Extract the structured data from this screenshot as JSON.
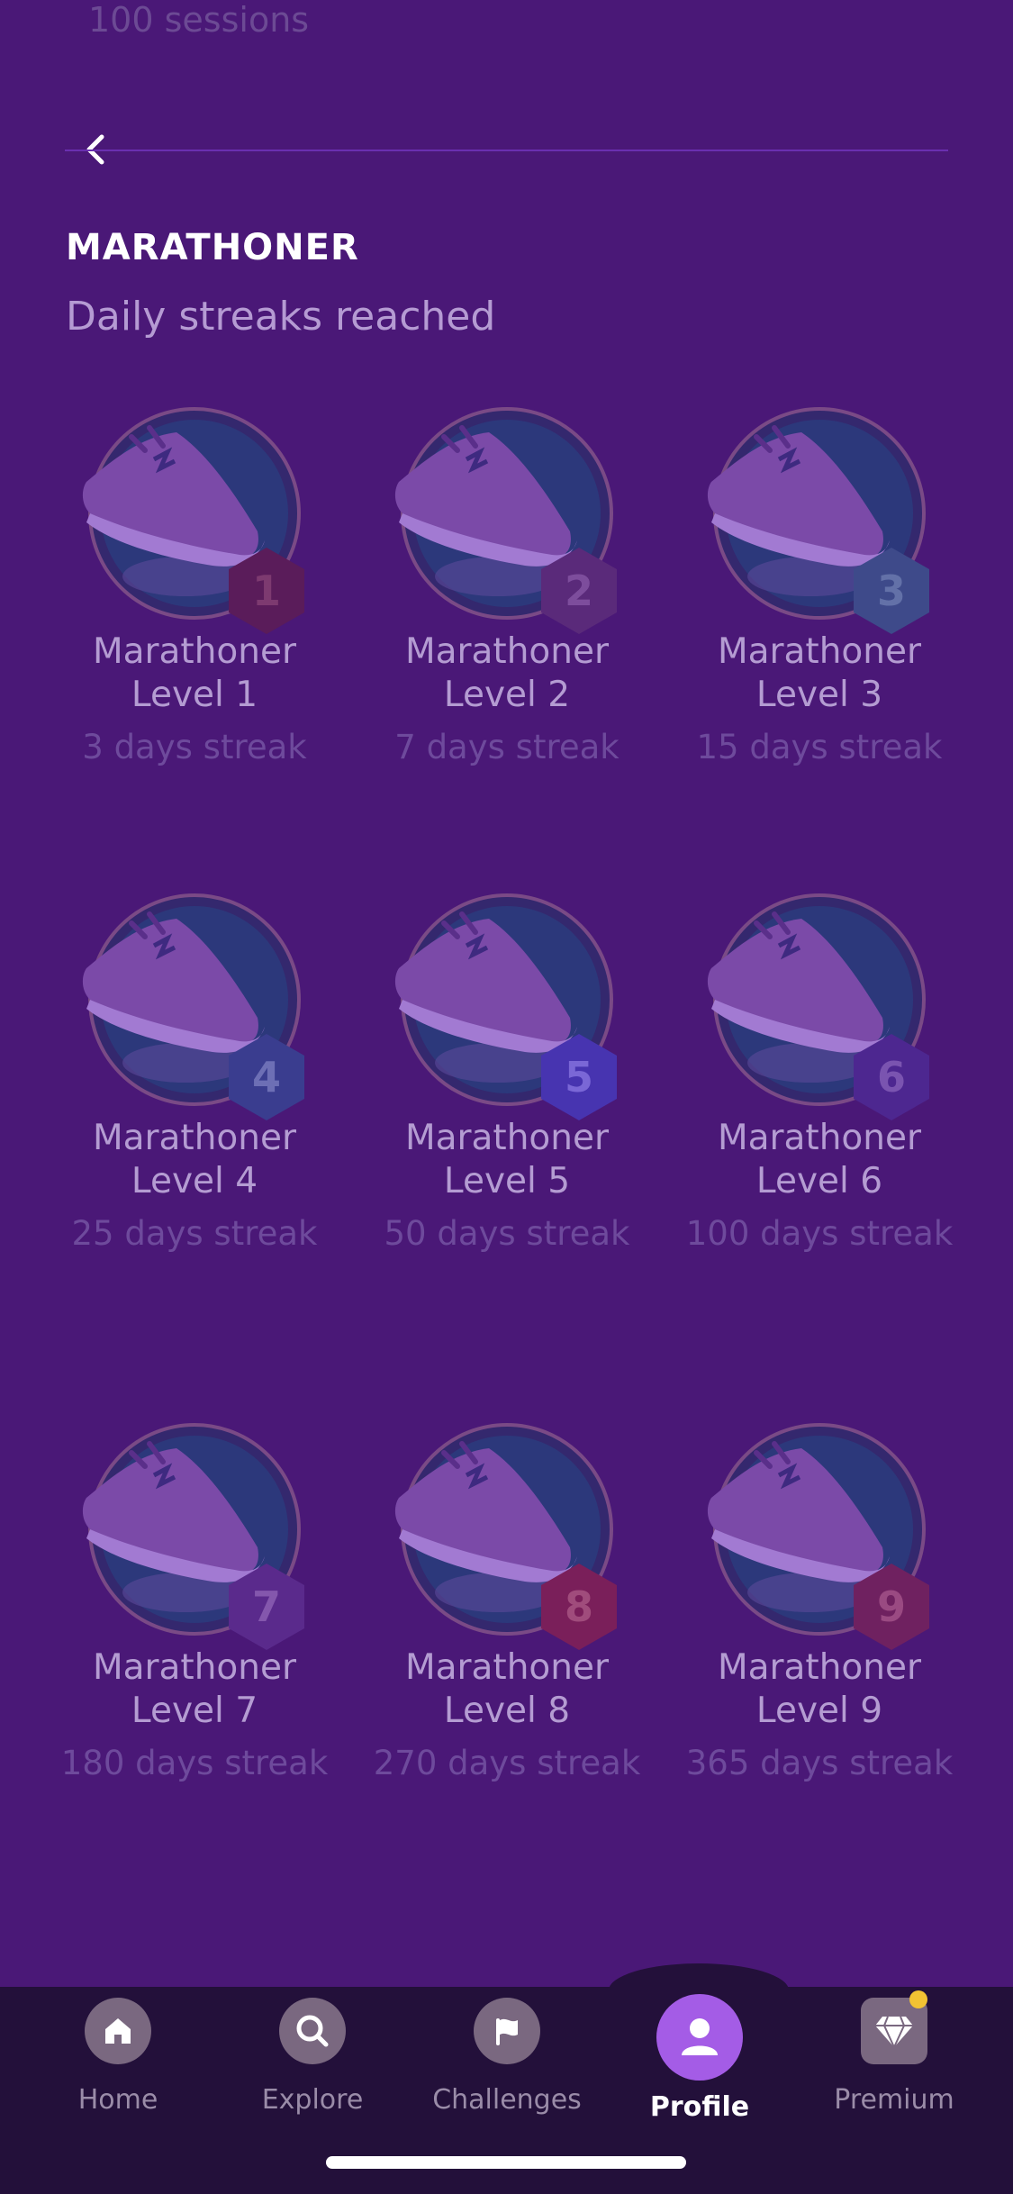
{
  "top_cut_text": "100 sessions",
  "header": {
    "title": "MARATHONER",
    "subtitle": "Daily streaks reached"
  },
  "badges": [
    {
      "name": "Marathoner Level 1",
      "requirement": "3 days streak",
      "level": "1",
      "hex_color": "#5a1c5a",
      "num_color": "#7d3a70"
    },
    {
      "name": "Marathoner Level 2",
      "requirement": "7 days streak",
      "level": "2",
      "hex_color": "#5a2a7a",
      "num_color": "#7d4d9c"
    },
    {
      "name": "Marathoner Level 3",
      "requirement": "15 days streak",
      "level": "3",
      "hex_color": "#3e4a8a",
      "num_color": "#6371a8"
    },
    {
      "name": "Marathoner Level 4",
      "requirement": "25 days streak",
      "level": "4",
      "hex_color": "#3a3d8f",
      "num_color": "#6d6fb5"
    },
    {
      "name": "Marathoner Level 5",
      "requirement": "50 days streak",
      "level": "5",
      "hex_color": "#4734b0",
      "num_color": "#7a67d6"
    },
    {
      "name": "Marathoner Level 6",
      "requirement": "100 days streak",
      "level": "6",
      "hex_color": "#4d2790",
      "num_color": "#7a54b0"
    },
    {
      "name": "Marathoner Level 7",
      "requirement": "180 days streak",
      "level": "7",
      "hex_color": "#5a2a8c",
      "num_color": "#8457ad"
    },
    {
      "name": "Marathoner Level 8",
      "requirement": "270 days streak",
      "level": "8",
      "hex_color": "#7a1f5a",
      "num_color": "#a04c7c"
    },
    {
      "name": "Marathoner Level 9",
      "requirement": "365 days streak",
      "level": "9",
      "hex_color": "#6f2160",
      "num_color": "#9a4a82"
    }
  ],
  "nav": {
    "home": "Home",
    "explore": "Explore",
    "challenges": "Challenges",
    "profile": "Profile",
    "premium": "Premium",
    "active": "Profile"
  },
  "colors": {
    "background": "#4a1877",
    "nav_background": "#23103a",
    "profile_active": "#a45ce6",
    "premium_badge_dot": "#f2c233"
  }
}
